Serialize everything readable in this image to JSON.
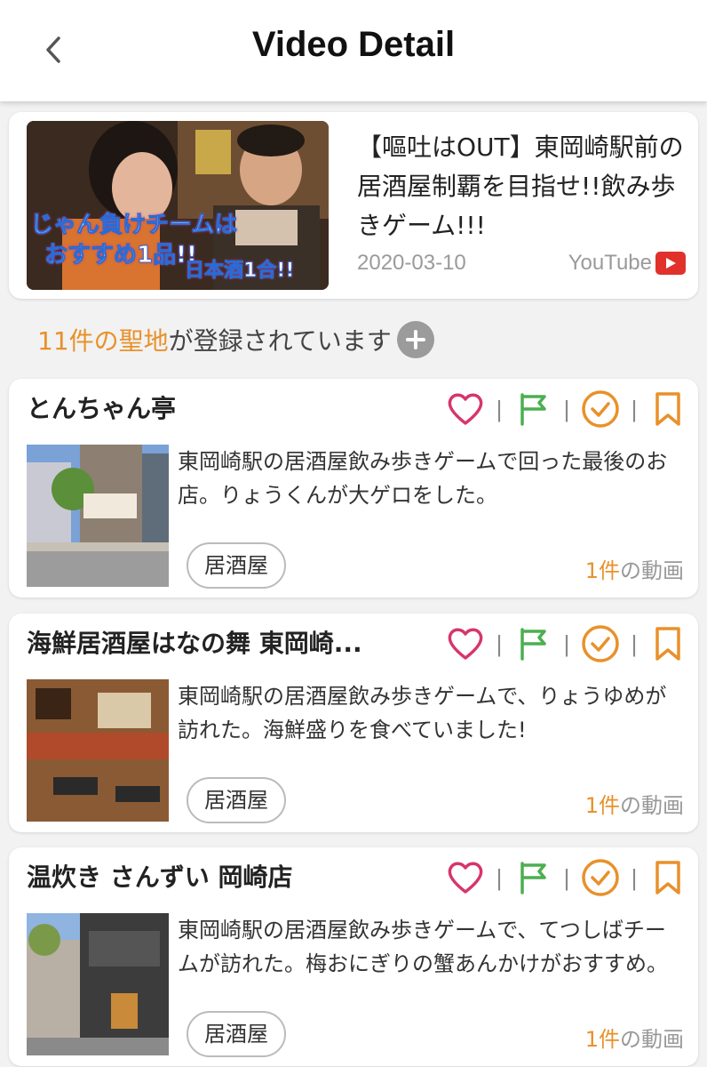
{
  "header": {
    "title": "Video Detail",
    "back_icon": "chevron-left-icon"
  },
  "video": {
    "thumbnail_text_1": "じゃん負けチームは",
    "thumbnail_text_2": "おすすめ1品!!",
    "thumbnail_text_3": "日本酒1合!!",
    "title": "【嘔吐はOUT】東岡崎駅前の居酒屋制覇を目指せ!!飲み歩きゲーム!!!",
    "date": "2020-03-10",
    "source": "YouTube"
  },
  "spots_header": {
    "count": "11件の聖地",
    "suffix": "が登録されています"
  },
  "colors": {
    "heart": "#d6356d",
    "flag": "#4caf50",
    "check": "#e8912a",
    "bookmark": "#e8912a",
    "accent": "#e8912a"
  },
  "spots": [
    {
      "name": "とんちゃん亭",
      "description": "東岡崎駅の居酒屋飲み歩きゲームで回った最後のお店。りょうくんが大ゲロをした。",
      "tag": "居酒屋",
      "video_count_num": "1件",
      "video_count_suffix": "の動画"
    },
    {
      "name": "海鮮居酒屋はなの舞 東岡崎...",
      "description": "東岡崎駅の居酒屋飲み歩きゲームで、りょうゆめが訪れた。海鮮盛りを食べていました!",
      "tag": "居酒屋",
      "video_count_num": "1件",
      "video_count_suffix": "の動画"
    },
    {
      "name": "温炊き さんずい 岡崎店",
      "description": "東岡崎駅の居酒屋飲み歩きゲームで、てつしばチームが訪れた。梅おにぎりの蟹あんかけがおすすめ。",
      "tag": "居酒屋",
      "video_count_num": "1件",
      "video_count_suffix": "の動画"
    }
  ]
}
